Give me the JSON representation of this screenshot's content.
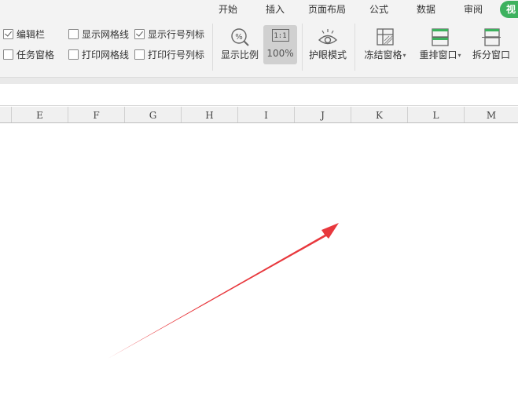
{
  "ribbon": {
    "tabs": [
      {
        "label": "开始"
      },
      {
        "label": "插入"
      },
      {
        "label": "页面布局"
      },
      {
        "label": "公式"
      },
      {
        "label": "数据"
      },
      {
        "label": "审阅"
      },
      {
        "label": "视",
        "active": true
      }
    ],
    "checkboxes": [
      {
        "label": "编辑栏",
        "checked": true
      },
      {
        "label": "任务窗格",
        "checked": false
      },
      {
        "label": "显示网格线",
        "checked": false
      },
      {
        "label": "打印网格线",
        "checked": false
      },
      {
        "label": "显示行号列标",
        "checked": true
      },
      {
        "label": "打印行号列标",
        "checked": false
      }
    ],
    "tools": {
      "zoom": {
        "label": "显示比例",
        "icon": "zoom-percent-icon"
      },
      "zoom100": {
        "label": "100%",
        "glyph": "1:1",
        "icon": "one-to-one-icon"
      },
      "eye": {
        "label": "护眼模式",
        "icon": "eye-icon"
      },
      "freeze": {
        "label": "冻结窗格",
        "icon": "freeze-panes-icon"
      },
      "arrange": {
        "label": "重排窗口",
        "icon": "arrange-windows-icon"
      },
      "split": {
        "label": "拆分窗口",
        "icon": "split-window-icon"
      }
    }
  },
  "sheet": {
    "columns": [
      "E",
      "F",
      "G",
      "H",
      "I",
      "J",
      "K",
      "L",
      "M"
    ]
  },
  "colors": {
    "accent": "#3db15e",
    "arrow": "#e8383d",
    "ribbon_bg": "#f3f3f3"
  }
}
